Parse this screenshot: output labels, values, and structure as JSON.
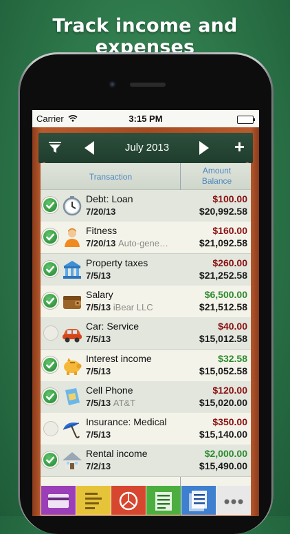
{
  "headline": "Track income and expenses",
  "status": {
    "carrier": "Carrier",
    "time": "3:15 PM"
  },
  "toolbar": {
    "month": "July 2013",
    "add_label": "+"
  },
  "columns": {
    "transaction": "Transaction",
    "amount_line1": "Amount",
    "amount_line2": "Balance"
  },
  "colors": {
    "expense": "#8a1010",
    "income": "#2d8a2d",
    "header_text": "#4a86c1"
  },
  "transactions": [
    {
      "name": "Debt: Loan",
      "date": "7/20/13",
      "note": "",
      "amount": "$100.00",
      "balance": "$20,992.58",
      "type": "expense",
      "cleared": true,
      "icon": "clock-icon"
    },
    {
      "name": "Fitness",
      "date": "7/20/13",
      "note": "Auto-gene…",
      "amount": "$160.00",
      "balance": "$21,092.58",
      "type": "expense",
      "cleared": true,
      "icon": "person-icon"
    },
    {
      "name": "Property taxes",
      "date": "7/5/13",
      "note": "",
      "amount": "$260.00",
      "balance": "$21,252.58",
      "type": "expense",
      "cleared": true,
      "icon": "bank-icon"
    },
    {
      "name": "Salary",
      "date": "7/5/13",
      "note": "iBear LLC",
      "amount": "$6,500.00",
      "balance": "$21,512.58",
      "type": "income",
      "cleared": true,
      "icon": "wallet-icon"
    },
    {
      "name": "Car: Service",
      "date": "7/5/13",
      "note": "",
      "amount": "$40.00",
      "balance": "$15,012.58",
      "type": "expense",
      "cleared": false,
      "icon": "car-icon"
    },
    {
      "name": "Interest income",
      "date": "7/5/13",
      "note": "",
      "amount": "$32.58",
      "balance": "$15,052.58",
      "type": "income",
      "cleared": true,
      "icon": "piggy-bank-icon"
    },
    {
      "name": "Cell Phone",
      "date": "7/5/13",
      "note": "AT&T",
      "amount": "$120.00",
      "balance": "$15,020.00",
      "type": "expense",
      "cleared": true,
      "icon": "sim-card-icon"
    },
    {
      "name": "Insurance: Medical",
      "date": "7/5/13",
      "note": "",
      "amount": "$350.00",
      "balance": "$15,140.00",
      "type": "expense",
      "cleared": false,
      "icon": "umbrella-icon"
    },
    {
      "name": "Rental income",
      "date": "7/2/13",
      "note": "",
      "amount": "$2,000.00",
      "balance": "$15,490.00",
      "type": "income",
      "cleared": true,
      "icon": "house-icon"
    }
  ],
  "tabs": [
    {
      "icon": "accounts-tab-icon",
      "color": "#9b3fb8"
    },
    {
      "icon": "notes-tab-icon",
      "color": "#e6c43a"
    },
    {
      "icon": "reports-tab-icon",
      "color": "#d7462e"
    },
    {
      "icon": "budget-tab-icon",
      "color": "#4cae3e"
    },
    {
      "icon": "list-tab-icon",
      "color": "#3f7fd0"
    },
    {
      "icon": "more-tab-icon",
      "color": "#e8e8e8"
    }
  ]
}
